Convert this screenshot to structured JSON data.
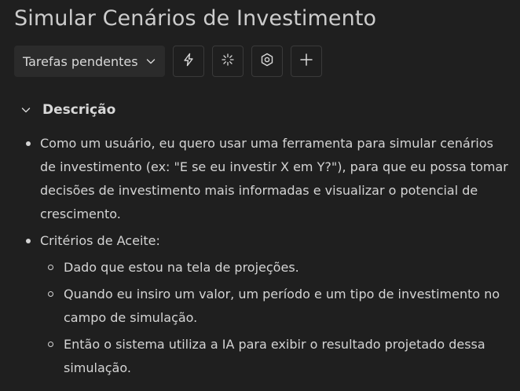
{
  "page": {
    "title": "Simular Cenários de Investimento"
  },
  "toolbar": {
    "status_label": "Tarefas pendentes",
    "status_icon": "chevron-down-icon",
    "buttons": [
      {
        "icon": "lightning-icon"
      },
      {
        "icon": "sparkle-icon"
      },
      {
        "icon": "hexagon-settings-icon"
      },
      {
        "icon": "plus-icon"
      }
    ]
  },
  "description": {
    "header": "Descrição",
    "items": [
      {
        "text": "Como um usuário, eu quero usar uma ferramenta para simular cenários de investimento (ex: \"E se eu investir X em Y?\"), para que eu possa tomar decisões de investimento mais informadas e visualizar o potencial de crescimento."
      },
      {
        "text": "Critérios de Aceite:",
        "subitems": [
          "Dado que estou na tela de projeções.",
          "Quando eu insiro um valor, um período e um tipo de investimento no campo de simulação.",
          "Então o sistema utiliza a IA para exibir o resultado projetado dessa simulação."
        ]
      }
    ]
  },
  "colors": {
    "background": "#1f1f1f",
    "text": "#d4d4d4",
    "button_bg": "#2b2b2b",
    "border": "#3a3a3a"
  }
}
